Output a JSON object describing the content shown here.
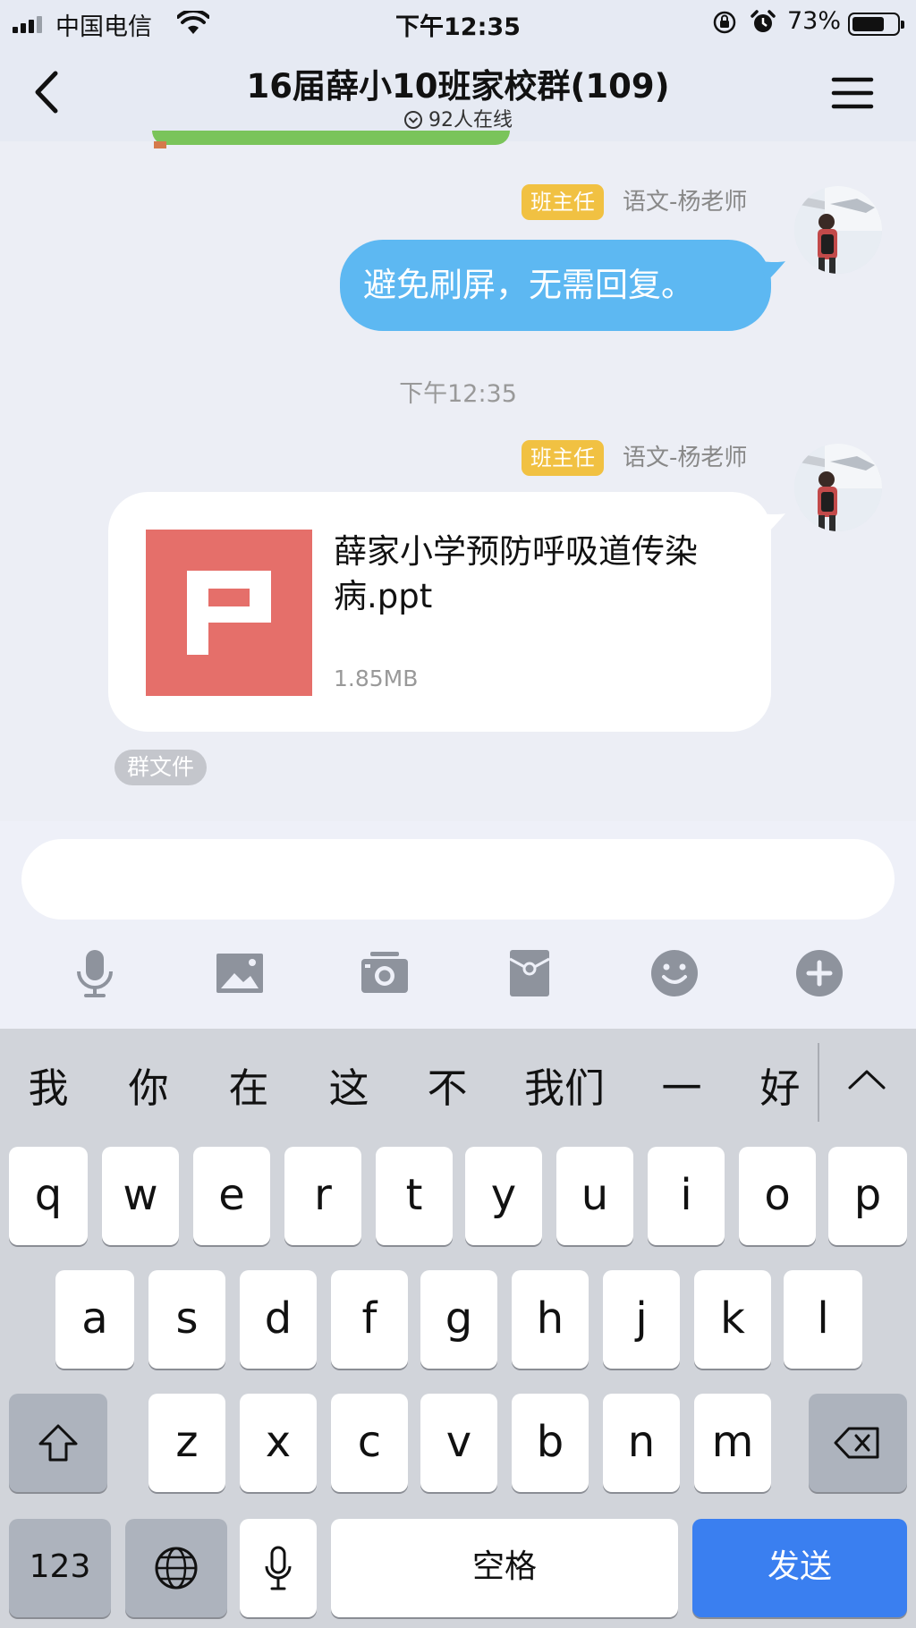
{
  "status_bar": {
    "carrier": "中国电信",
    "time": "下午12:35",
    "battery": "73%",
    "battery_level": 0.73
  },
  "nav": {
    "title": "16届薛小10班家校群(109)",
    "online": "92人在线"
  },
  "messages": [
    {
      "tag": "班主任",
      "sender": "语文-杨老师",
      "text": "避免刷屏，无需回复。"
    },
    {
      "tag": "班主任",
      "sender": "语文-杨老师",
      "file": {
        "name": "薛家小学预防呼吸道传染病.ppt",
        "size": "1.85MB",
        "badge": "群文件",
        "icon": "ppt-file-icon"
      }
    }
  ],
  "time_divider": "下午12:35",
  "input": {
    "value": "",
    "placeholder": ""
  },
  "toolbar": [
    "mic-icon",
    "image-icon",
    "camera-icon",
    "red-packet-icon",
    "emoji-icon",
    "plus-icon"
  ],
  "keyboard": {
    "candidates": [
      "我",
      "你",
      "在",
      "这",
      "不",
      "我们",
      "一",
      "好"
    ],
    "row1": [
      "q",
      "w",
      "e",
      "r",
      "t",
      "y",
      "u",
      "i",
      "o",
      "p"
    ],
    "row2": [
      "a",
      "s",
      "d",
      "f",
      "g",
      "h",
      "j",
      "k",
      "l"
    ],
    "row3": [
      "z",
      "x",
      "c",
      "v",
      "b",
      "n",
      "m"
    ],
    "numbers_label": "123",
    "space_label": "空格",
    "send_label": "发送"
  },
  "colors": {
    "accent_blue": "#3a7ff0",
    "bubble_blue": "#5db8f2",
    "tag_yellow": "#f1c142",
    "ppt_red": "#e56f6a"
  }
}
